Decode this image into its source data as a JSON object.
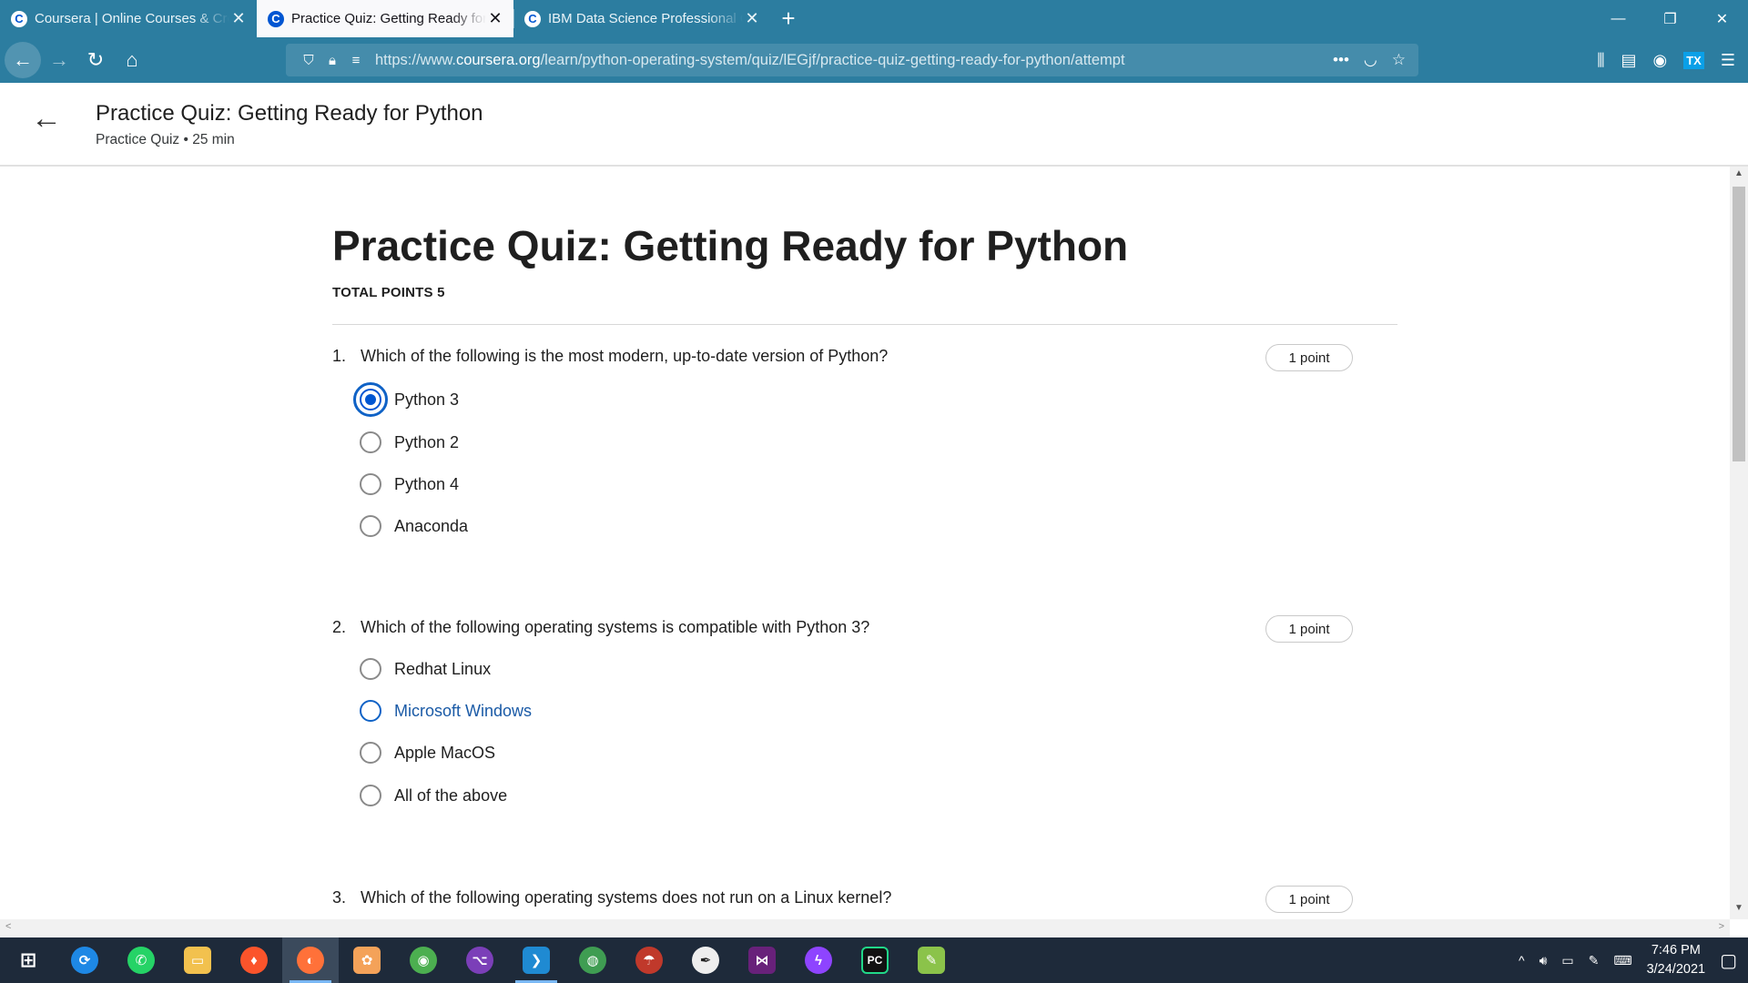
{
  "browser": {
    "tabs": [
      {
        "label": "Coursera | Online Courses & Credentials",
        "active": false
      },
      {
        "label": "Practice Quiz: Getting Ready for Python",
        "active": true
      },
      {
        "label": "IBM Data Science Professional Certificate",
        "active": false
      }
    ],
    "new_tab": "+",
    "url_prefix": "https://www.",
    "url_domain": "coursera.org",
    "url_path": "/learn/python-operating-system/quiz/lEGjf/practice-quiz-getting-ready-for-python/attempt",
    "tx_badge": "TX"
  },
  "header": {
    "title": "Practice Quiz: Getting Ready for Python",
    "subtitle": "Practice Quiz • 25 min"
  },
  "quiz": {
    "title": "Practice Quiz: Getting Ready for Python",
    "total_points": "TOTAL POINTS 5",
    "questions": [
      {
        "number": "1.",
        "text": "Which of the following is the most modern, up-to-date version of Python?",
        "points": "1 point",
        "options": [
          "Python 3",
          "Python 2",
          "Python 4",
          "Anaconda"
        ],
        "selected": "Python 3"
      },
      {
        "number": "2.",
        "text": "Which of the following operating systems is compatible with Python 3?",
        "points": "1 point",
        "options": [
          "Redhat Linux",
          "Microsoft Windows",
          "Apple MacOS",
          "All of the above"
        ],
        "hovered": "Microsoft Windows"
      },
      {
        "number": "3.",
        "text": "Which of the following operating systems does not run on a Linux kernel?",
        "points": "1 point",
        "options": []
      }
    ]
  },
  "taskbar": {
    "apps": [
      "start",
      "feedback-hub",
      "whatsapp",
      "file-explorer",
      "brave",
      "firefox",
      "photos",
      "chrome",
      "github-desktop",
      "vscode",
      "maps",
      "mushroom-app",
      "inkscape",
      "visual-studio",
      "messenger",
      "pycharm",
      "notepad"
    ],
    "time": "7:46 PM",
    "date": "3/24/2021"
  }
}
